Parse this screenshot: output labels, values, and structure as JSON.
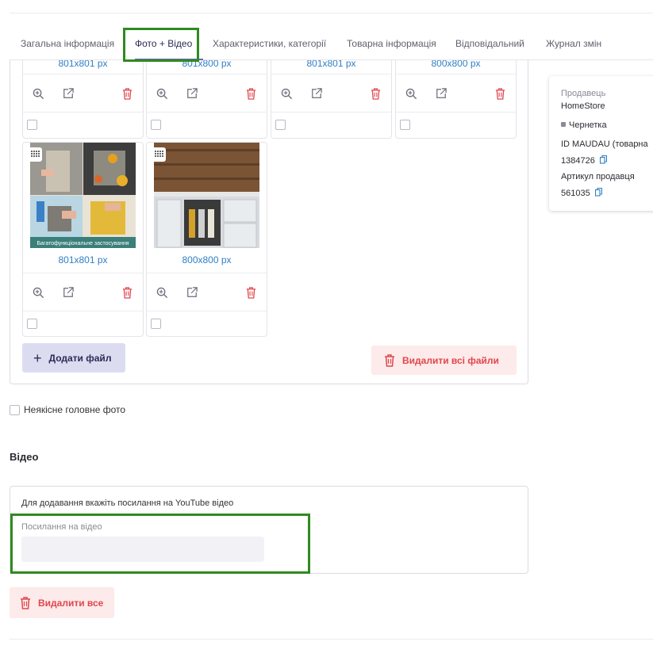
{
  "tabs": [
    {
      "label": "Загальна інформація"
    },
    {
      "label": "Фото + Відео"
    },
    {
      "label": "Характеристики, категорії"
    },
    {
      "label": "Товарна інформація"
    },
    {
      "label": "Відповідальний"
    },
    {
      "label": "Журнал змін"
    }
  ],
  "images": [
    {
      "size": "801x801 px"
    },
    {
      "size": "801x800 px"
    },
    {
      "size": "801x801 px"
    },
    {
      "size": "800x800 px"
    },
    {
      "size": "801x801 px",
      "caption": "Багатофункціональне застосування"
    },
    {
      "size": "800x800 px"
    }
  ],
  "buttons": {
    "add_file": "Додати файл",
    "delete_all_files": "Видалити всі файли",
    "delete_all": "Видалити все"
  },
  "low_quality_label": "Неякісне головне фото",
  "video": {
    "title": "Відео",
    "hint": "Для додавання вкажіть посилання на YouTube відео",
    "link_label": "Посилання на відео",
    "link_value": ""
  },
  "info": {
    "seller_label": "Продавець",
    "seller_value": "HomeStore",
    "status": "Чернетка",
    "id_label": "ID MAUDAU (товарна",
    "id_value": "1384726",
    "article_label": "Артикул продавця",
    "article_value": "561035"
  },
  "colors": {
    "accent": "#6b5fb8",
    "link": "#2f7fc4",
    "danger": "#e0474d",
    "highlight": "#2e8b1f"
  }
}
